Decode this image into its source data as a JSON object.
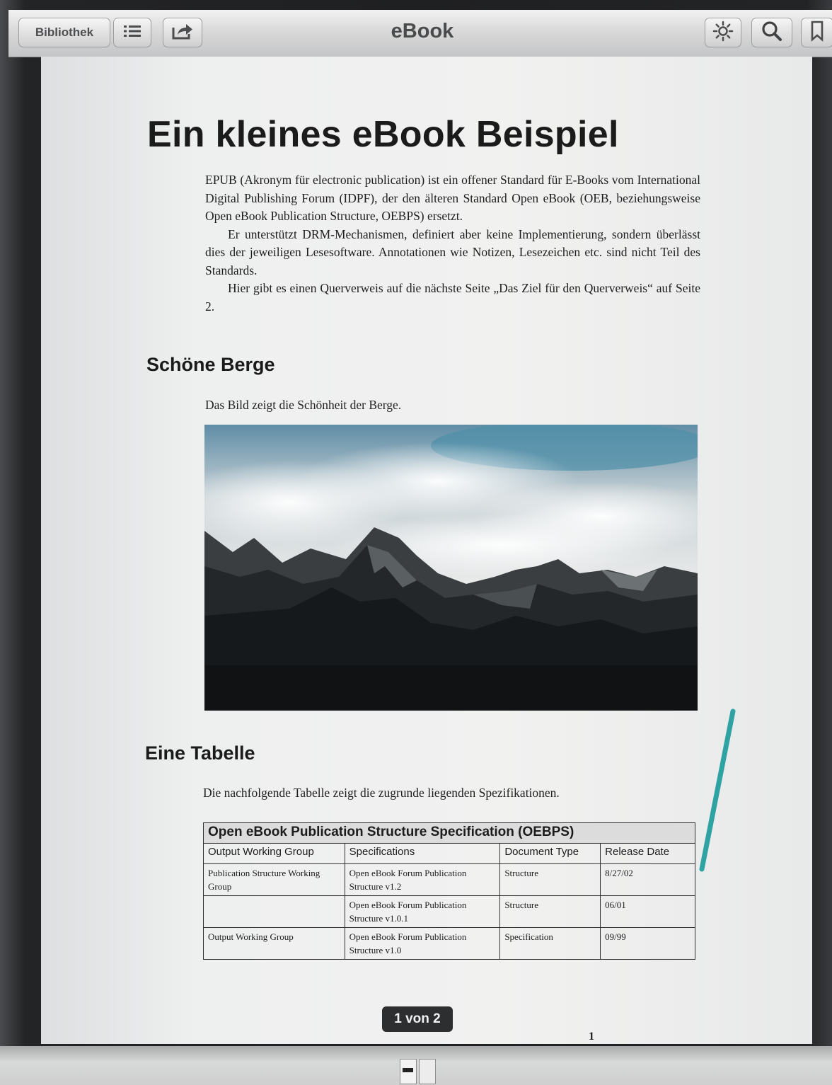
{
  "toolbar": {
    "library_label": "Bibliothek",
    "title": "eBook"
  },
  "document": {
    "title": "Ein kleines eBook Beispiel",
    "intro": [
      "EPUB (Akronym für electronic publication) ist ein offener Standard für E-Books vom International Digital Publishing Forum (IDPF), der den älteren Standard Open eBook (OEB, beziehungsweise Open eBook Publication Structure, OEBPS) ersetzt.",
      "Er unterstützt DRM-Mechanismen, definiert aber keine Implementierung, sondern überlässt dies der jeweiligen Lesesoftware. Annotationen wie Notizen, Lesezeichen etc. sind nicht Teil des Standards.",
      "Hier gibt es einen Querverweis auf die nächste Seite „Das Ziel für den Querverweis“ auf Seite 2."
    ],
    "section_mountains": {
      "heading": "Schöne Berge",
      "text": "Das Bild zeigt die Schönheit der Berge."
    },
    "section_table": {
      "heading": "Eine Tabelle",
      "text": "Die nachfolgende Tabelle zeigt die zugrunde liegenden Spezifikationen.",
      "caption": "Open eBook Publication Structure Specification (OEBPS)",
      "columns": [
        "Output Working Group",
        "Specifications",
        "Document Type",
        "Release Date"
      ],
      "rows": [
        [
          "Publication Structure Working Group",
          "Open eBook Forum Publication Structure v1.2",
          "Structure",
          "8/27/02"
        ],
        [
          "",
          "Open eBook Forum Publication Structure v1.0.1",
          "Structure",
          "06/01"
        ],
        [
          "Output Working Group",
          "Open eBook Forum Publication Structure v1.0",
          "Specification",
          "09/99"
        ]
      ]
    },
    "page_indicator": "1 von 2",
    "page_number": "1"
  },
  "colors": {
    "accent_line": "#2fa3a3",
    "toolbar_bg": "#d6d6d6",
    "page_bg": "#efefee"
  }
}
